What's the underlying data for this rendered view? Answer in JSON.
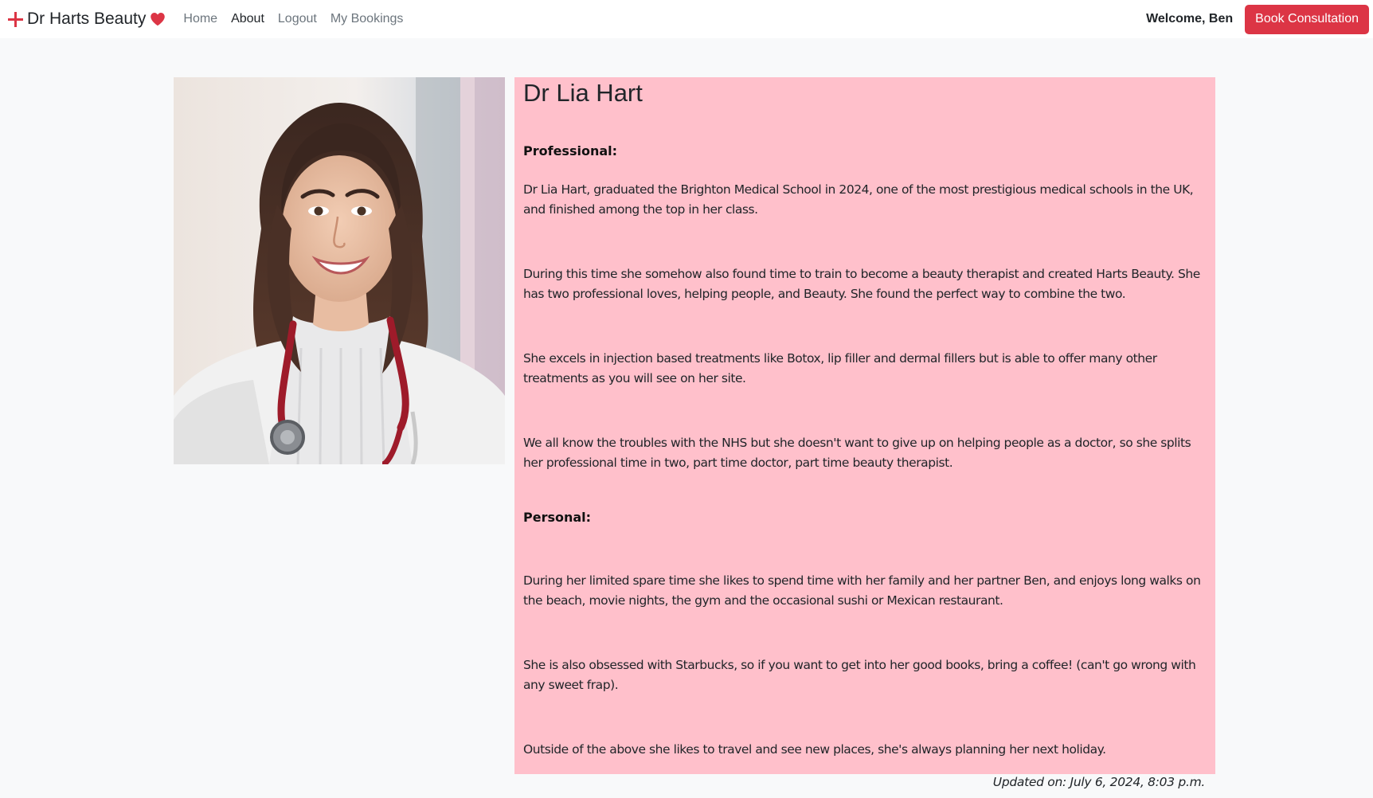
{
  "navbar": {
    "brand": "Dr Harts Beauty",
    "links": {
      "home": "Home",
      "about": "About",
      "logout": "Logout",
      "bookings": "My Bookings"
    },
    "welcome": "Welcome, Ben",
    "cta": "Book Consultation"
  },
  "profile": {
    "name": "Dr Lia Hart",
    "photo_alt": "",
    "sections": {
      "professional": {
        "heading": "Professional:",
        "paragraphs": [
          "Dr Lia Hart, graduated the Brighton Medical School in 2024, one of the most prestigious medical schools in the UK, and finished among the top in her class.",
          "During this time she somehow also found time to train to become a beauty therapist and created Harts Beauty. She has two professional loves, helping people, and Beauty. She found the perfect way to combine the two.",
          "She excels in injection based treatments like Botox, lip filler and dermal fillers but is able to offer many other treatments as you will see on her site.",
          "We all know the troubles with the NHS but she doesn't want to give up on helping people as a doctor, so she splits her professional time in two, part time doctor, part time beauty therapist."
        ]
      },
      "personal": {
        "heading": "Personal:",
        "paragraphs": [
          "During her limited spare time she likes to spend time with her family and her partner Ben, and enjoys long walks on the beach, movie nights, the gym and the occasional sushi or Mexican restaurant.",
          "She is also obsessed with Starbucks, so if you want to get into her good books, bring a coffee! (can't go wrong with any sweet frap).",
          "Outside of the above she likes to travel and see new places, she's always planning her next holiday."
        ]
      }
    },
    "updated": "Updated on: July 6, 2024, 8:03 p.m."
  },
  "icons": {
    "brand_plus": "plus-icon",
    "brand_heart": "heart-icon"
  },
  "colors": {
    "accent": "#dc3545",
    "panel": "#ffc0cb",
    "page_bg": "#f8f9fa",
    "nav_bg": "#ffffff",
    "muted_link": "#6c757d"
  }
}
